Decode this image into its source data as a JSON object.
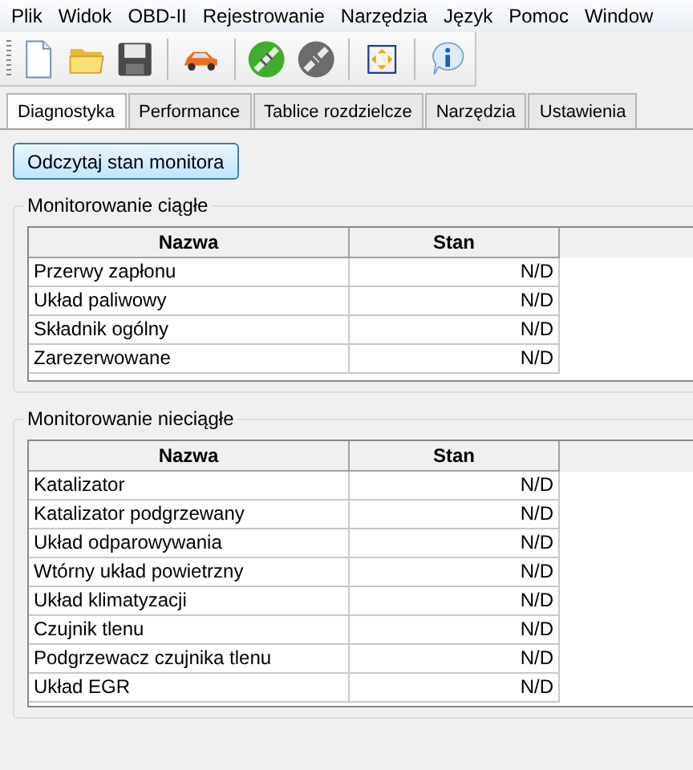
{
  "menu": [
    "Plik",
    "Widok",
    "OBD-II",
    "Rejestrowanie",
    "Narzędzia",
    "Język",
    "Pomoc",
    "Window"
  ],
  "toolbar": [
    {
      "kind": "new"
    },
    {
      "kind": "open"
    },
    {
      "kind": "save"
    },
    {
      "kind": "sep"
    },
    {
      "kind": "car"
    },
    {
      "kind": "sep"
    },
    {
      "kind": "connect"
    },
    {
      "kind": "disconnect"
    },
    {
      "kind": "sep"
    },
    {
      "kind": "fit"
    },
    {
      "kind": "sep"
    },
    {
      "kind": "info"
    }
  ],
  "tabs": [
    {
      "label": "Diagnostyka",
      "selected": true
    },
    {
      "label": "Performance",
      "selected": false
    },
    {
      "label": "Tablice rozdzielcze",
      "selected": false
    },
    {
      "label": "Narzędzia",
      "selected": false
    },
    {
      "label": "Ustawienia",
      "selected": false
    }
  ],
  "read_button": "Odczytaj stan monitora",
  "groups": [
    {
      "title": "Monitorowanie ciągłe",
      "columns": [
        "Nazwa",
        "Stan"
      ],
      "rows": [
        [
          "Przerwy zapłonu",
          "N/D"
        ],
        [
          "Układ paliwowy",
          "N/D"
        ],
        [
          "Składnik ogólny",
          "N/D"
        ],
        [
          "Zarezerwowane",
          "N/D"
        ]
      ]
    },
    {
      "title": "Monitorowanie nieciągłe",
      "columns": [
        "Nazwa",
        "Stan"
      ],
      "rows": [
        [
          "Katalizator",
          "N/D"
        ],
        [
          "Katalizator podgrzewany",
          "N/D"
        ],
        [
          "Układ odparowywania",
          "N/D"
        ],
        [
          "Wtórny układ powietrzny",
          "N/D"
        ],
        [
          "Układ klimatyzacji",
          "N/D"
        ],
        [
          "Czujnik tlenu",
          "N/D"
        ],
        [
          "Podgrzewacz czujnika tlenu",
          "N/D"
        ],
        [
          "Układ EGR",
          "N/D"
        ]
      ]
    }
  ]
}
